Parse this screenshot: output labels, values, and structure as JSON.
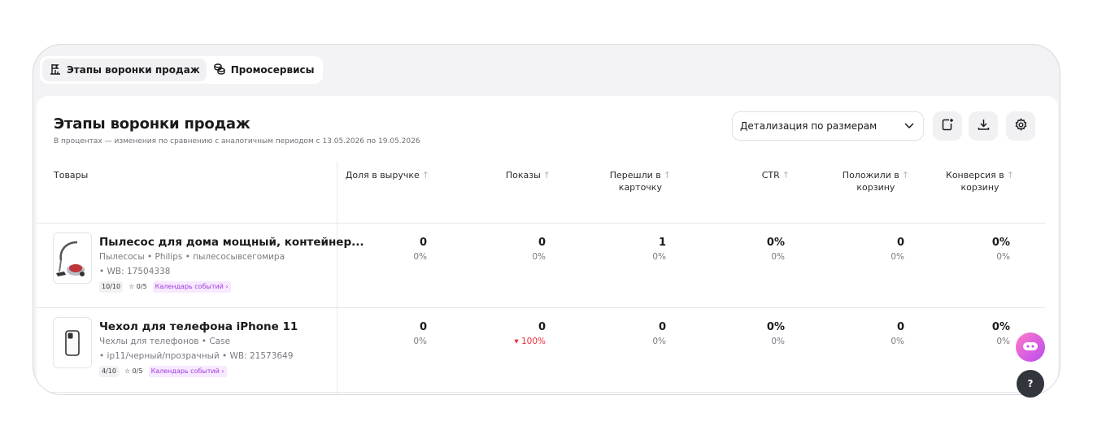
{
  "tabs": [
    {
      "label": "Этапы воронки продаж",
      "icon": "funnel-flag-icon",
      "active": true
    },
    {
      "label": "Промосервисы",
      "icon": "coins-icon",
      "active": false
    }
  ],
  "header": {
    "title": "Этапы воронки продаж",
    "subtitle": "В процентах — изменения по сравнению с аналогичным периодом с 13.05.2026 по 19.05.2026",
    "detail_select": "Детализация по размерам"
  },
  "columns": {
    "products": "Товары",
    "revenue_share": "Доля в выручке",
    "views": "Показы",
    "to_card_1": "Перешли в",
    "to_card_2": "карточку",
    "ctr": "CTR",
    "to_cart_1": "Положили в",
    "to_cart_2": "корзину",
    "conv_1": "Конверсия в",
    "conv_2": "корзину"
  },
  "rows": [
    {
      "name": "Пылесос для дома мощный, контейнер...",
      "meta": "Пылесосы • Philips • пылесосывсегомира",
      "meta2": "• WB: 17504338",
      "rating": "10/10",
      "reviews": "☆ 0/5",
      "calendar": "Календарь событий ›",
      "revenue": {
        "v": "0",
        "p": "0%"
      },
      "views": {
        "v": "0",
        "p": "0%"
      },
      "card": {
        "v": "1",
        "p": "0%"
      },
      "ctr": {
        "v": "0%",
        "p": "0%"
      },
      "cart": {
        "v": "0",
        "p": "0%"
      },
      "conv": {
        "v": "0%",
        "p": "0%"
      }
    },
    {
      "name": "Чехол для телефона iPhone 11",
      "meta": "Чехлы для телефонов • Case",
      "meta2": "• ip11/черный/прозрачный • WB: 21573649",
      "rating": "4/10",
      "reviews": "☆ 0/5",
      "calendar": "Календарь событий ›",
      "revenue": {
        "v": "0",
        "p": "0%"
      },
      "views": {
        "v": "0",
        "p": "▾ 100%"
      },
      "card": {
        "v": "0",
        "p": "0%"
      },
      "ctr": {
        "v": "0%",
        "p": "0%"
      },
      "cart": {
        "v": "0",
        "p": "0%"
      },
      "conv": {
        "v": "0%",
        "p": "0%"
      }
    }
  ],
  "help": {
    "label": "?"
  },
  "colors": {
    "accent_pink": "#ff7ac8",
    "negative": "#ef2d3b",
    "calendar_tag": "#a13be0"
  }
}
